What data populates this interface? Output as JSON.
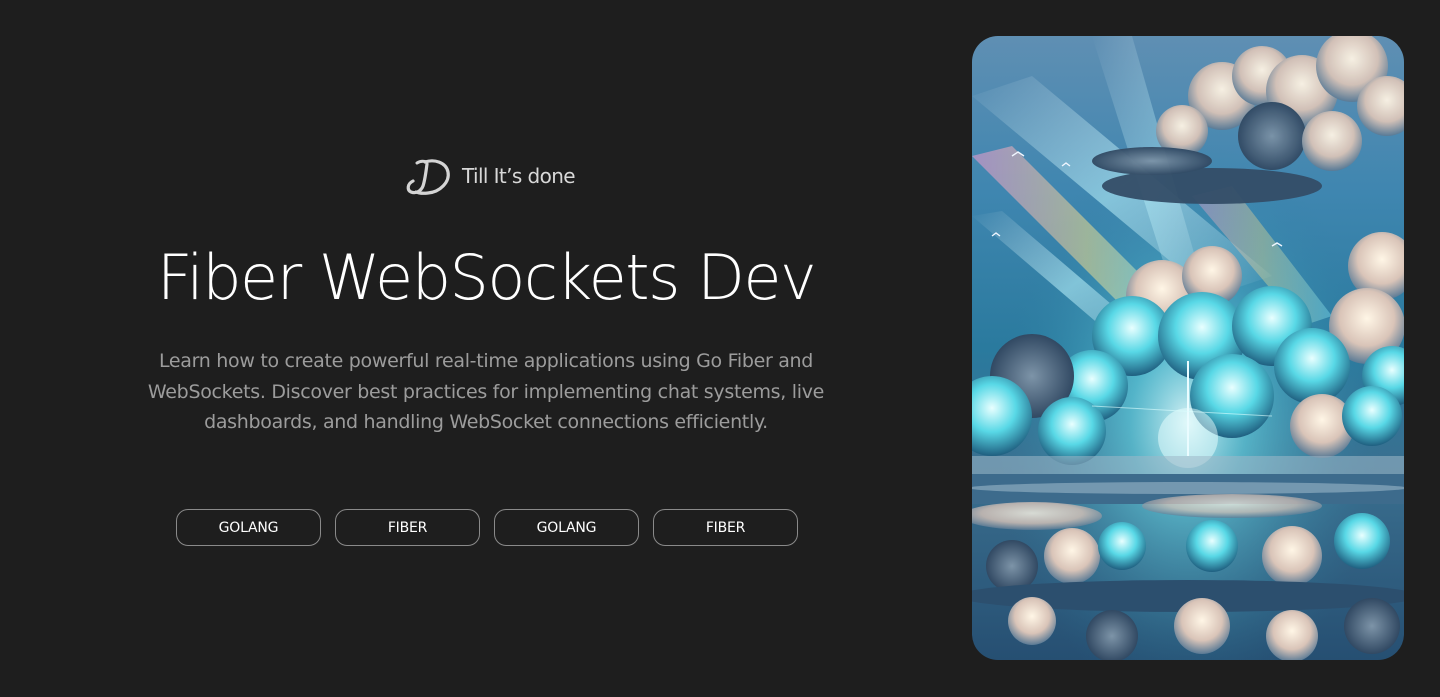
{
  "brand": {
    "name": "Till It’s done",
    "logo_icon": "cursive-d-logo-icon"
  },
  "hero": {
    "title": "Fiber WebSockets Dev",
    "description": "Learn how to create powerful real-time applications using Go Fiber and WebSockets. Discover best practices for implementing chat systems, live dashboards, and handling WebSocket connections efficiently."
  },
  "tags": [
    {
      "label": "GOLANG"
    },
    {
      "label": "FIBER"
    },
    {
      "label": "GOLANG"
    },
    {
      "label": "FIBER"
    }
  ],
  "colors": {
    "background": "#1e1e1e",
    "text": "#ffffff",
    "muted_text": "#9c9c9c",
    "tag_border": "#8a8a8a"
  }
}
